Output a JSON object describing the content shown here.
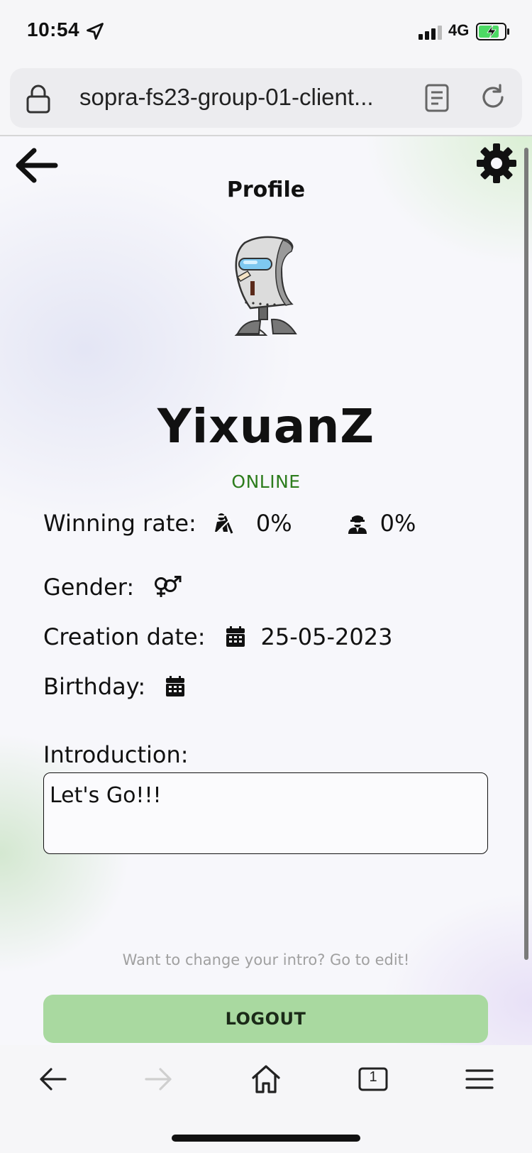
{
  "status_bar": {
    "time": "10:54",
    "network": "4G",
    "battery_level": 0.75,
    "charging": true
  },
  "browser": {
    "url": "sopra-fs23-group-01-client...",
    "open_tabs": "1"
  },
  "header": {
    "title": "Profile",
    "back_icon": "arrow-left-icon",
    "settings_icon": "gear-icon"
  },
  "profile": {
    "avatar_icon": "robot-avatar",
    "username": "YixuanZ",
    "status": "ONLINE",
    "status_color": "#2e7d1e",
    "winning_rate_label": "Winning rate:",
    "winning_rate_1": "0%",
    "winning_rate_2": "0%",
    "gender_label": "Gender:",
    "creation_date_label": "Creation date:",
    "creation_date": "25-05-2023",
    "birthday_label": "Birthday:",
    "birthday": "",
    "introduction_label": "Introduction:",
    "introduction": "Let's Go!!!",
    "edit_hint": "Want to change your intro? Go to edit!",
    "logout_label": "LOGOUT",
    "logout_color": "#a9d9a0"
  }
}
